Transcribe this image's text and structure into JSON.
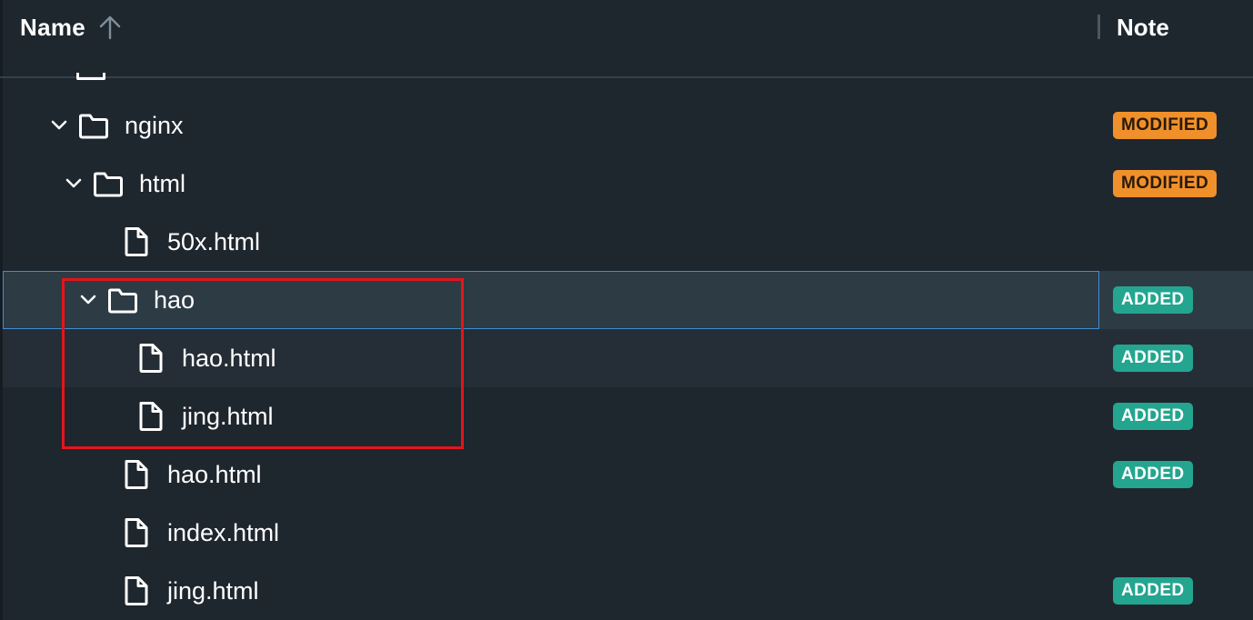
{
  "header": {
    "name_label": "Name",
    "note_label": "Note",
    "sort_icon": "arrow-up-icon"
  },
  "rows": [
    {
      "label": "nginx",
      "kind": "folder",
      "expanded": true,
      "depth": 0,
      "badge": "MODIFIED",
      "badge_type": "modified"
    },
    {
      "label": "html",
      "kind": "folder",
      "expanded": true,
      "depth": 1,
      "badge": "MODIFIED",
      "badge_type": "modified"
    },
    {
      "label": "50x.html",
      "kind": "file",
      "depth": 2,
      "badge": "",
      "badge_type": ""
    },
    {
      "label": "hao",
      "kind": "folder",
      "expanded": true,
      "depth": 2,
      "badge": "ADDED",
      "badge_type": "added",
      "selected": true
    },
    {
      "label": "hao.html",
      "kind": "file",
      "depth": 3,
      "badge": "ADDED",
      "badge_type": "added"
    },
    {
      "label": "jing.html",
      "kind": "file",
      "depth": 3,
      "badge": "ADDED",
      "badge_type": "added"
    },
    {
      "label": "hao.html",
      "kind": "file",
      "depth": 2,
      "badge": "ADDED",
      "badge_type": "added"
    },
    {
      "label": "index.html",
      "kind": "file",
      "depth": 2,
      "badge": "",
      "badge_type": ""
    },
    {
      "label": "jing.html",
      "kind": "file",
      "depth": 2,
      "badge": "ADDED",
      "badge_type": "added"
    }
  ],
  "colors": {
    "modified": "#f0902a",
    "added": "#23a58f",
    "selection_outline": "#3f8fd8",
    "annotation": "#e5141c"
  }
}
